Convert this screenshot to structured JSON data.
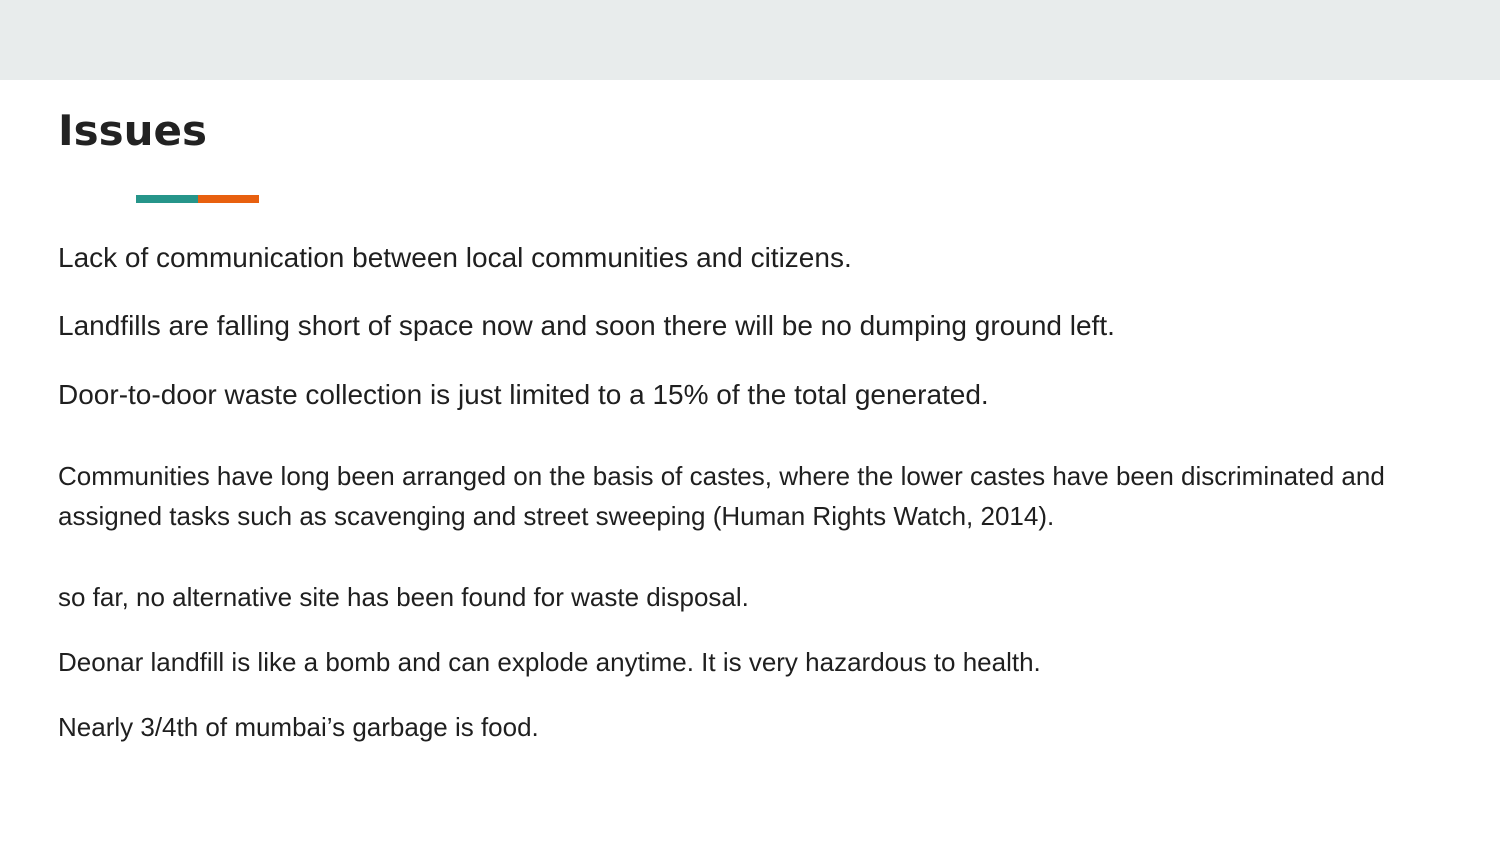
{
  "slide": {
    "title": "Issues",
    "accent": {
      "left_color": "#26958a",
      "right_color": "#e8600f"
    },
    "points": [
      "Lack of communication between local communities and citizens.",
      "Landfills are falling short of space now and soon there will be no dumping ground left.",
      "Door-to-door waste collection is just limited to a 15% of the total generated.",
      "Communities have long been arranged on the basis of castes, where the lower castes have been discriminated and assigned tasks such as scavenging and street sweeping (Human Rights Watch, 2014).",
      "so far, no alternative site has been found for waste disposal.",
      "Deonar landfill is like a bomb and can explode anytime. It is very hazardous to health.",
      "Nearly 3/4th of mumbai’s garbage is food."
    ]
  }
}
